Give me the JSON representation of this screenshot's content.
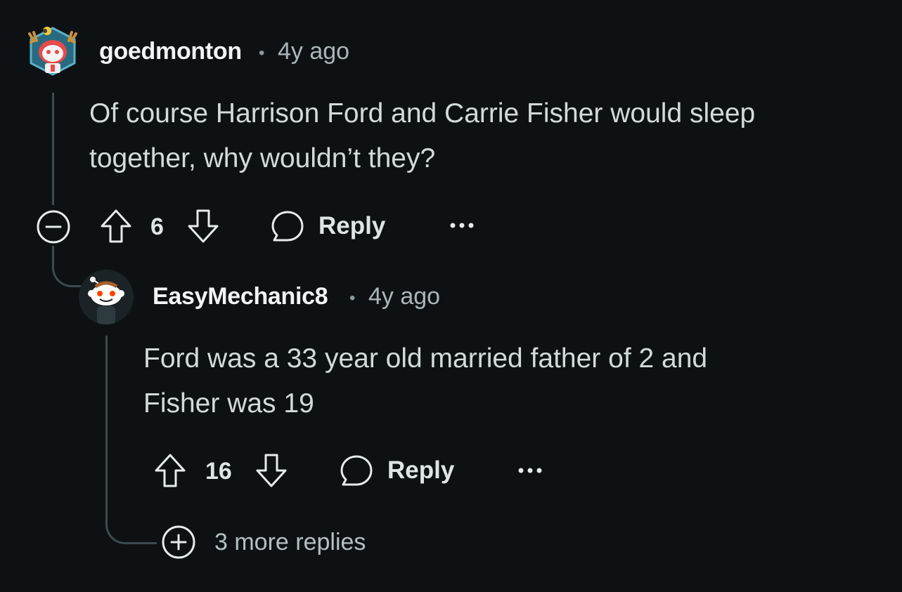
{
  "comments": [
    {
      "username": "goedmonton",
      "separator": "•",
      "time": "4y ago",
      "body_lines": [
        "Of course Harrison Ford and Carrie Fisher would sleep",
        "together, why wouldn’t they?"
      ],
      "score": "6",
      "reply_label": "Reply",
      "avatar_icon": "snoo-avatar-moose"
    },
    {
      "username": "EasyMechanic8",
      "separator": "•",
      "time": "4y ago",
      "body_lines": [
        "Ford was a 33 year old married father of 2 and",
        "Fisher was 19"
      ],
      "score": "16",
      "reply_label": "Reply",
      "avatar_icon": "snoo-avatar-default"
    }
  ],
  "more_replies": "3 more replies",
  "colors": {
    "background": "#0e1113",
    "thread_line": "#3e4a4f",
    "text": "#d3dadc"
  }
}
